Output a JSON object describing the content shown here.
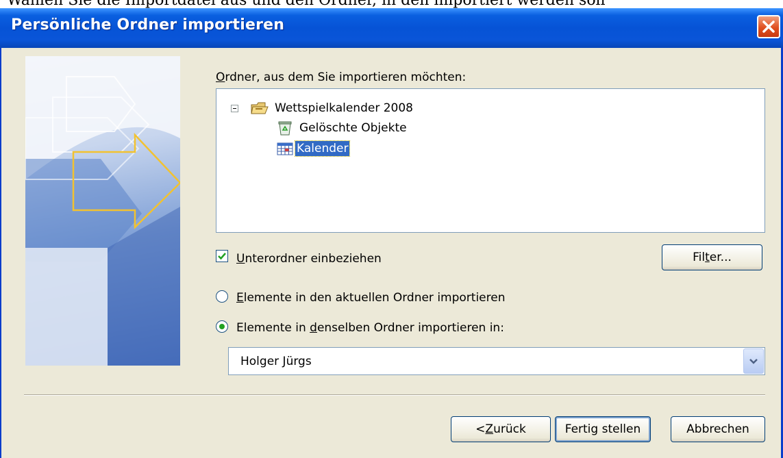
{
  "window": {
    "title": "Persönliche Ordner importieren"
  },
  "tree": {
    "label_prefix": "O",
    "label_rest": "rdner, aus dem Sie importieren möchten:",
    "items": [
      {
        "label": "Wettspielkalender 2008",
        "icon": "pst-folder-icon"
      },
      {
        "label": "Gelöschte Objekte",
        "icon": "recycle-bin-icon"
      },
      {
        "label": "Kalender",
        "icon": "calendar-icon",
        "selected": true
      }
    ]
  },
  "options": {
    "include_subfolders": {
      "prefix": "U",
      "rest": "nterordner einbeziehen",
      "checked": true
    },
    "filter_button": {
      "pre": "Fil",
      "ul": "t",
      "post": "er..."
    },
    "radio_current": {
      "prefix": "E",
      "rest": "lemente in den aktuellen Ordner importieren",
      "selected": false
    },
    "radio_same": {
      "pre": "Elemente in ",
      "ul": "d",
      "post": "enselben Ordner importieren in:",
      "selected": true
    },
    "target_value": "Holger Jürgs"
  },
  "buttons": {
    "back": {
      "pre": "< ",
      "ul": "Z",
      "post": "urück"
    },
    "finish": "Fertig stellen",
    "cancel": "Abbrechen"
  },
  "colors": {
    "titlebar": "#0653d6",
    "dialog_bg": "#ece9d8",
    "selection": "#316ac5",
    "radio_dot": "#21a121"
  }
}
